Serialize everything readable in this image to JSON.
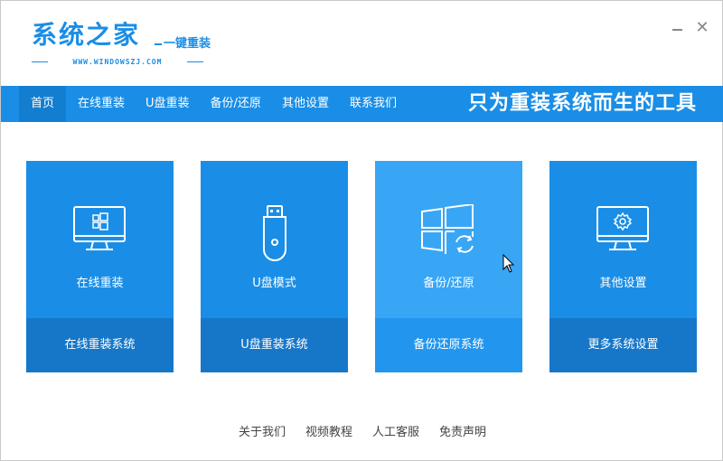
{
  "app": {
    "logo_main": "系统之家",
    "logo_sub": "一键重装",
    "logo_url": "WWW.WINDOWSZJ.COM",
    "minimize_label": "",
    "close_label": "✕"
  },
  "nav": {
    "items": [
      {
        "label": "首页"
      },
      {
        "label": "在线重装"
      },
      {
        "label": "U盘重装"
      },
      {
        "label": "备份/还原"
      },
      {
        "label": "其他设置"
      },
      {
        "label": "联系我们"
      }
    ],
    "active_index": 0,
    "slogan": "只为重装系统而生的工具"
  },
  "cards": [
    {
      "label": "在线重装",
      "foot": "在线重装系统",
      "icon": "monitor-windows-icon"
    },
    {
      "label": "U盘模式",
      "foot": "U盘重装系统",
      "icon": "usb-drive-icon"
    },
    {
      "label": "备份/还原",
      "foot": "备份还原系统",
      "icon": "windows-restore-icon"
    },
    {
      "label": "其他设置",
      "foot": "更多系统设置",
      "icon": "monitor-gear-icon"
    }
  ],
  "footer": {
    "links": [
      {
        "label": "关于我们"
      },
      {
        "label": "视频教程"
      },
      {
        "label": "人工客服"
      },
      {
        "label": "免责声明"
      }
    ]
  },
  "colors": {
    "primary": "#1a8ee6",
    "card_foot": "#1677c9",
    "card_hover": "#38a6f5",
    "nav_active": "#137ed0"
  }
}
